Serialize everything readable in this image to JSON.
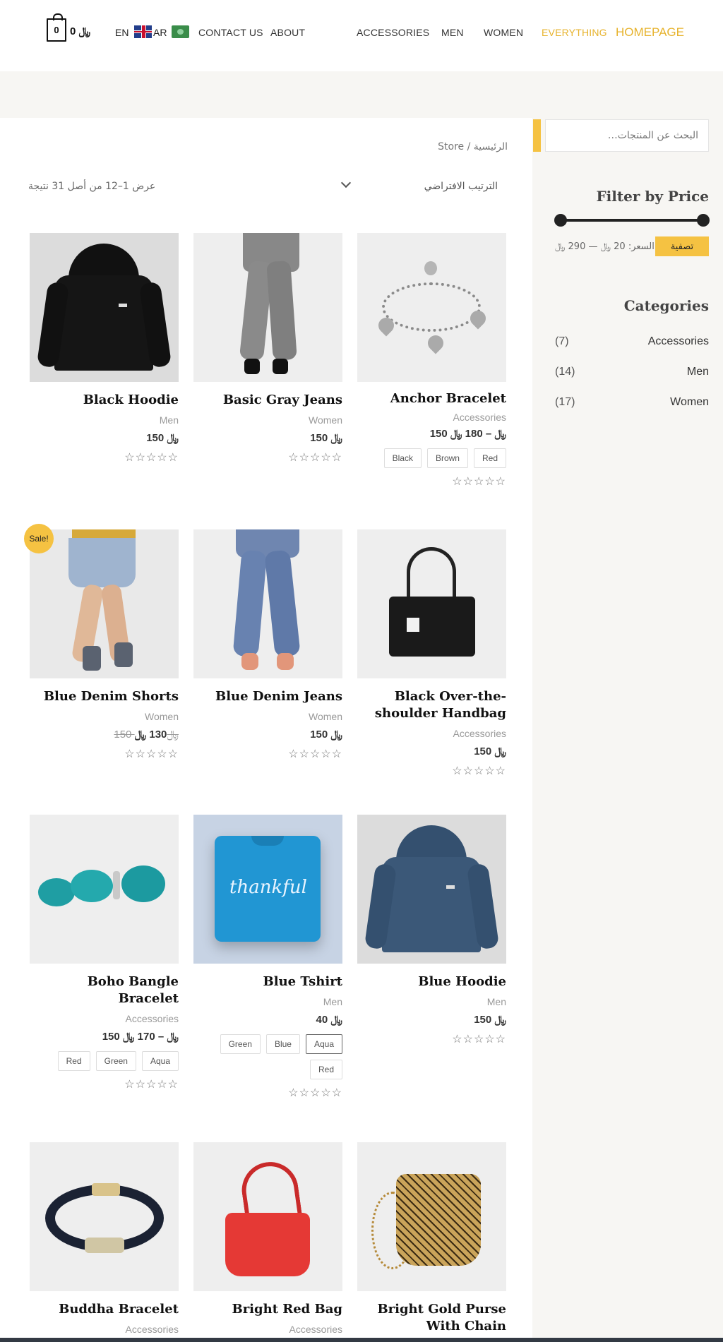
{
  "header": {
    "cart_count": "0",
    "cart_total": "0 ﷼",
    "lang_en": "EN",
    "lang_ar": "AR",
    "nav": [
      {
        "label": "CONTACT US"
      },
      {
        "label": "ABOUT"
      },
      {
        "label": "ACCESSORIES"
      },
      {
        "label": "MEN"
      },
      {
        "label": "WOMEN"
      },
      {
        "label": "EVERYTHING"
      },
      {
        "label": "HOMEPAGE"
      }
    ],
    "accent_color": "#e7b32d"
  },
  "sidebar": {
    "search_placeholder": "البحث عن المنتجات…",
    "filter_title": "Filter by Price",
    "filter_button": "تصفية",
    "price_label": "السعر: 20 ﷼ — 290 ﷼",
    "categories_title": "Categories",
    "categories": [
      {
        "name": "Accessories",
        "count": "(7)"
      },
      {
        "name": "Men",
        "count": "(14)"
      },
      {
        "name": "Women",
        "count": "(17)"
      }
    ]
  },
  "main": {
    "breadcrumb": "الرئيسية / Store",
    "sort_label": "الترتيب الافتراضي",
    "result_count": "عرض 1–12 من أصل 31 نتيجة",
    "sale_badge": "Sale!",
    "products": [
      {
        "name": "Black Hoodie",
        "category": "Men",
        "price": "150 ﷼",
        "old_price": "",
        "rating_icons": "☆☆☆☆☆",
        "swatches": []
      },
      {
        "name": "Basic Gray Jeans",
        "category": "Women",
        "price": "150 ﷼",
        "old_price": "",
        "rating_icons": "☆☆☆☆☆",
        "swatches": []
      },
      {
        "name": "Anchor Bracelet",
        "category": "Accessories",
        "price": "150 ﷼ – 180 ﷼",
        "old_price": "",
        "rating_icons": "☆☆☆☆☆",
        "swatches": [
          "Black",
          "Brown",
          "Red"
        ]
      },
      {
        "name": "Blue Denim Shorts",
        "category": "Women",
        "price": "130 ﷼",
        "old_price": "150 ﷼",
        "rating_icons": "☆☆☆☆☆",
        "swatches": []
      },
      {
        "name": "Blue Denim Jeans",
        "category": "Women",
        "price": "150 ﷼",
        "old_price": "",
        "rating_icons": "☆☆☆☆☆",
        "swatches": []
      },
      {
        "name": "Black Over-the-shoulder Handbag",
        "category": "Accessories",
        "price": "150 ﷼",
        "old_price": "",
        "rating_icons": "☆☆☆☆☆",
        "swatches": []
      },
      {
        "name": "Boho Bangle Bracelet",
        "category": "Accessories",
        "price": "150 ﷼ – 170 ﷼",
        "old_price": "",
        "rating_icons": "☆☆☆☆☆",
        "swatches": [
          "Aqua",
          "Green",
          "Red"
        ]
      },
      {
        "name": "Blue Tshirt",
        "category": "Men",
        "price": "40 ﷼",
        "old_price": "",
        "rating_icons": "☆☆☆☆☆",
        "swatches": [
          "Aqua",
          "Blue",
          "Green",
          "Red"
        ]
      },
      {
        "name": "Blue Hoodie",
        "category": "Men",
        "price": "150 ﷼",
        "old_price": "",
        "rating_icons": "☆☆☆☆☆",
        "swatches": []
      },
      {
        "name": "Buddha Bracelet",
        "category": "Accessories"
      },
      {
        "name": "Bright Red Bag",
        "category": "Accessories"
      },
      {
        "name": "Bright Gold Purse With Chain",
        "category": ""
      }
    ],
    "tshirt_print": "thankful"
  }
}
